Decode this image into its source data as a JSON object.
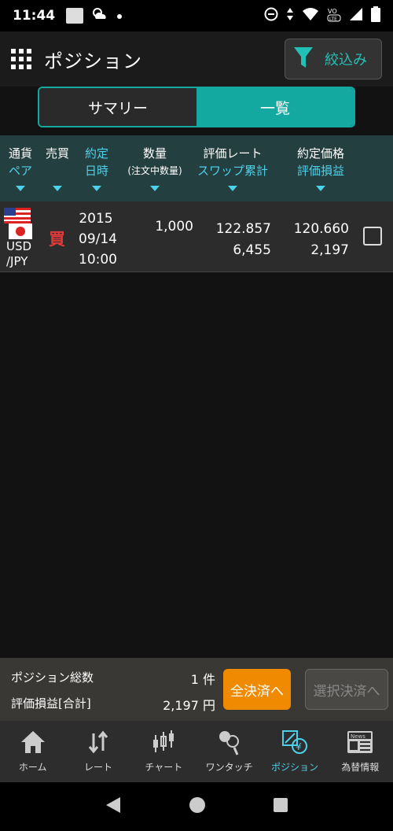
{
  "status_bar": {
    "time": "11:44"
  },
  "header": {
    "title": "ポジション",
    "filter_label": "絞込み"
  },
  "tabs": [
    {
      "label": "サマリー"
    },
    {
      "label": "一覧"
    }
  ],
  "columns": {
    "pair": [
      "通貨",
      "ペア"
    ],
    "side": "売買",
    "date": [
      "約定",
      "日時"
    ],
    "qty": [
      "数量",
      "(注文中数量)"
    ],
    "rate": [
      "評価レート",
      "スワップ累計"
    ],
    "price": [
      "約定価格",
      "評価損益"
    ]
  },
  "positions": [
    {
      "pair": [
        "USD",
        "/JPY"
      ],
      "side": "買",
      "date": [
        "2015",
        "09/14",
        "10:00"
      ],
      "qty": "1,000",
      "rate": "122.857",
      "swap": "6,455",
      "price": "120.660",
      "pnl": "2,197"
    }
  ],
  "summary": {
    "count_label": "ポジション総数",
    "count_value": "1 件",
    "pnl_label": "評価損益[合計]",
    "pnl_value": "2,197 円",
    "close_all": "全決済へ",
    "close_selected": "選択決済へ"
  },
  "nav": [
    {
      "label": "ホーム",
      "icon": "home-icon"
    },
    {
      "label": "レート",
      "icon": "rate-arrows-icon"
    },
    {
      "label": "チャート",
      "icon": "candlestick-icon"
    },
    {
      "label": "ワンタッチ",
      "icon": "one-touch-icon"
    },
    {
      "label": "ポジション",
      "icon": "position-icon"
    },
    {
      "label": "為替情報",
      "icon": "news-icon",
      "badge_text": "News"
    }
  ],
  "colors": {
    "accent": "#13a8a0",
    "header_blue": "#4fd0ea",
    "buy_red": "#e23a3a",
    "orange": "#f08a00"
  }
}
